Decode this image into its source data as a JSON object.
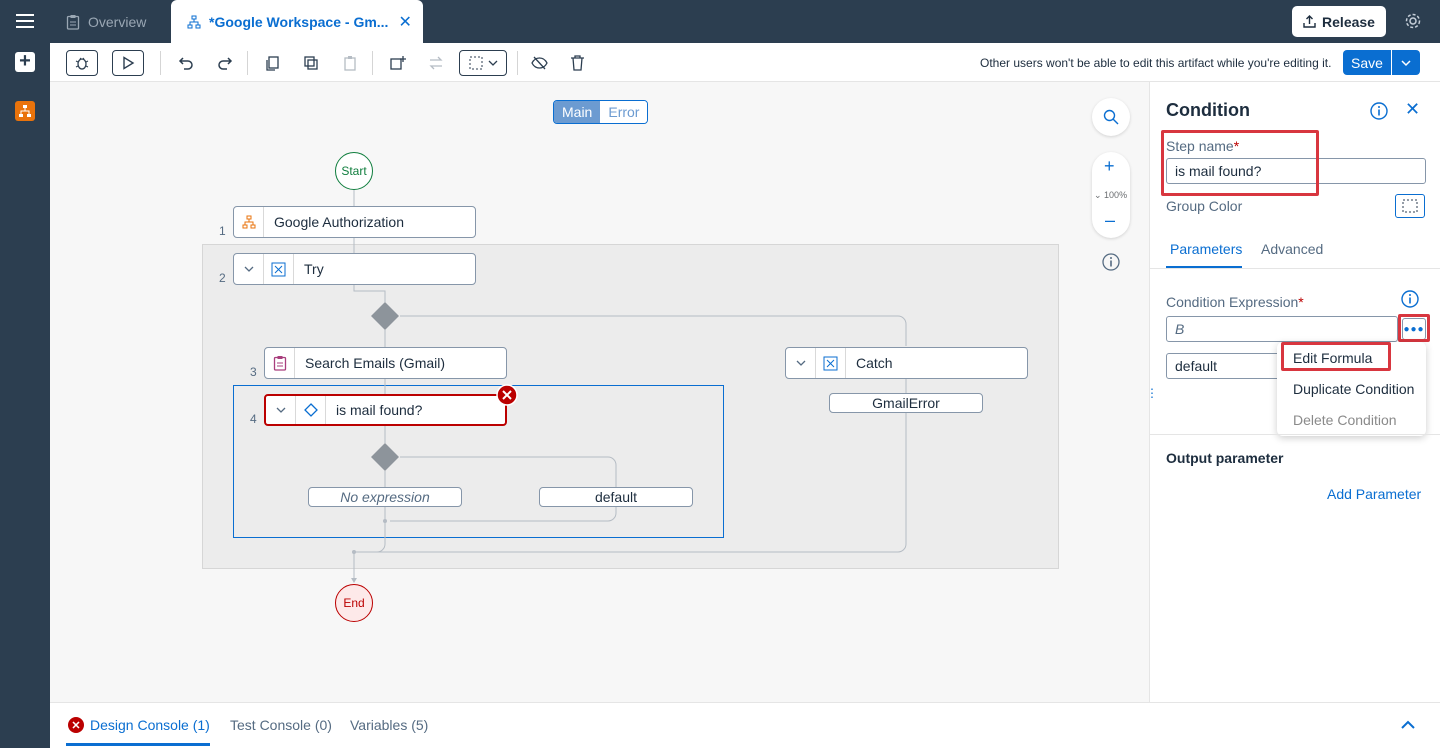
{
  "header": {
    "tabs": [
      {
        "label": "Overview"
      },
      {
        "label": "*Google Workspace - Gm...",
        "close": "✕"
      }
    ],
    "release_label": "Release"
  },
  "toolbar": {
    "edit_note": "Other users won't be able to edit this artifact while you're editing it.",
    "save_label": "Save"
  },
  "canvas": {
    "segments": [
      "Main",
      "Error"
    ],
    "start_label": "Start",
    "end_label": "End",
    "zoom_level": "100%",
    "steps": [
      {
        "num": "1",
        "label": "Google Authorization"
      },
      {
        "num": "2",
        "label": "Try"
      },
      {
        "num": "3",
        "label": "Search Emails (Gmail)"
      },
      {
        "num": "4",
        "label": "is mail found?"
      }
    ],
    "catch_label": "Catch",
    "gmail_error_label": "GmailError",
    "branch_no_expr": "No expression",
    "branch_default": "default"
  },
  "panel": {
    "title": "Condition",
    "step_name_label": "Step name",
    "required_mark": "*",
    "step_name_value": "is mail found?",
    "group_color_label": "Group Color",
    "tabs": [
      "Parameters",
      "Advanced"
    ],
    "cond_expr_label": "Condition Expression",
    "cond_expr_value": "B",
    "default_value": "default",
    "menu": [
      "Edit Formula",
      "Duplicate Condition",
      "Delete Condition"
    ],
    "output_title": "Output parameter",
    "add_param_label": "Add Parameter"
  },
  "console": {
    "tabs": [
      "Design Console (1)",
      "Test Console (0)",
      "Variables (5)"
    ]
  },
  "colors": {
    "accent": "#0a6ed1",
    "header": "#2c3e50",
    "error": "#bb0000",
    "highlight": "#d8363f"
  }
}
